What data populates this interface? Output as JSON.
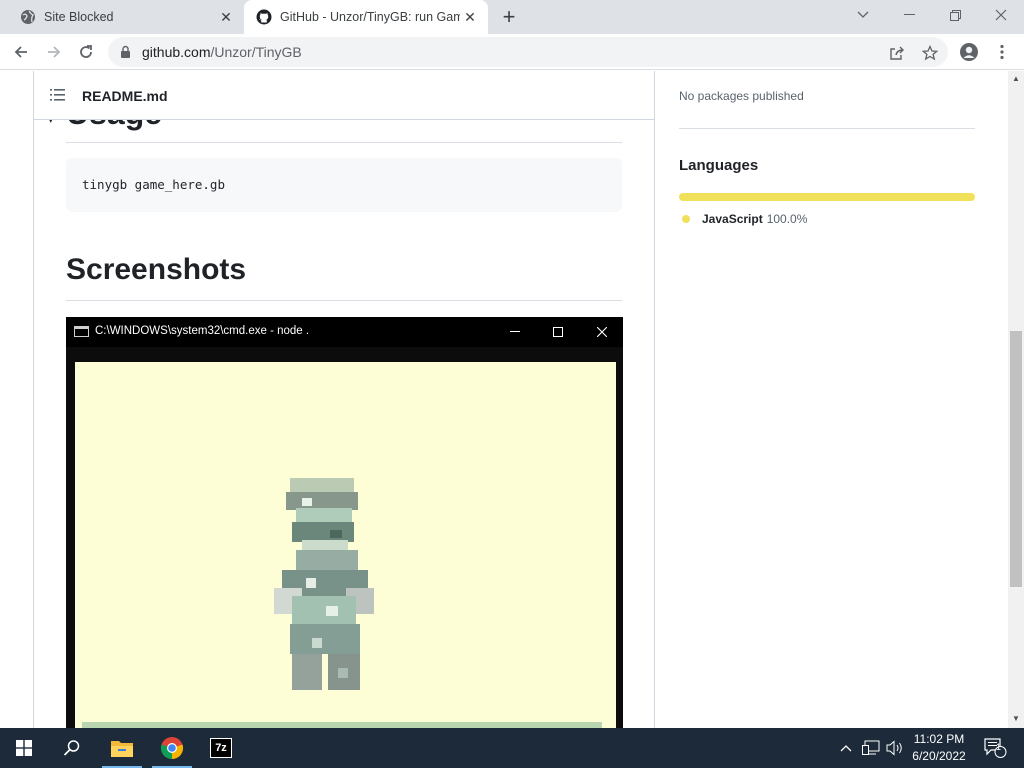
{
  "browser": {
    "tabs": [
      {
        "title": "Site Blocked",
        "active": false
      },
      {
        "title": "GitHub - Unzor/TinyGB: run Gam",
        "active": true
      }
    ],
    "url_domain": "github.com",
    "url_path": "/Unzor/TinyGB"
  },
  "readme": {
    "filename": "README.md",
    "usage_heading": "Usage",
    "code": "tinygb game_here.gb",
    "screenshots_heading": "Screenshots",
    "screenshot": {
      "window_title": "C:\\WINDOWS\\system32\\cmd.exe - node  ."
    }
  },
  "sidebar": {
    "packages_text": "No packages published",
    "languages_heading": "Languages",
    "languages": [
      {
        "name": "JavaScript",
        "percent": "100.0%",
        "fraction": 1.0,
        "color": "#f1e05a"
      }
    ]
  },
  "taskbar": {
    "time": "11:02 PM",
    "date": "6/20/2022",
    "notification_count": "1",
    "apps": [
      "file-explorer",
      "chrome",
      "7zip"
    ],
    "sevenzip_label": "7z"
  },
  "colors": {
    "taskbar_bg": "#1c2a3a",
    "accent_active": "#76b9ed",
    "gameboy_bg": "#fdfdd6"
  }
}
